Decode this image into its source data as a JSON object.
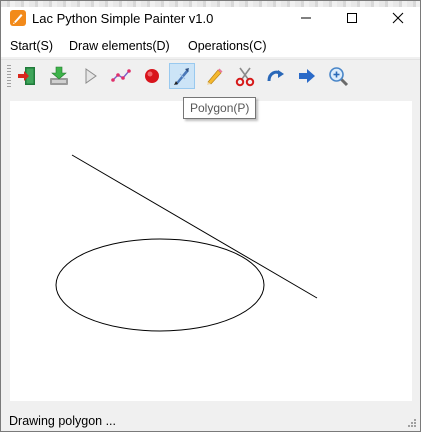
{
  "window": {
    "title": "Lac Python Simple Painter v1.0"
  },
  "menu": {
    "items": [
      "Start(S)",
      "Draw elements(D)",
      "Operations(C)"
    ]
  },
  "toolbar": {
    "buttons": [
      {
        "icon": "exit-icon"
      },
      {
        "icon": "save-icon"
      },
      {
        "icon": "play-icon"
      },
      {
        "icon": "polyline-icon"
      },
      {
        "icon": "circle-icon"
      },
      {
        "icon": "polygon-icon",
        "active": true
      },
      {
        "icon": "pencil-icon"
      },
      {
        "icon": "scissors-icon"
      },
      {
        "icon": "rotate-icon"
      },
      {
        "icon": "arrow-right-icon"
      },
      {
        "icon": "zoom-icon"
      }
    ],
    "tooltip": "Polygon(P)"
  },
  "status": {
    "text": "Drawing polygon ..."
  },
  "colors": {
    "accent": "#f28a1a",
    "active_button": "#cce4f7"
  }
}
